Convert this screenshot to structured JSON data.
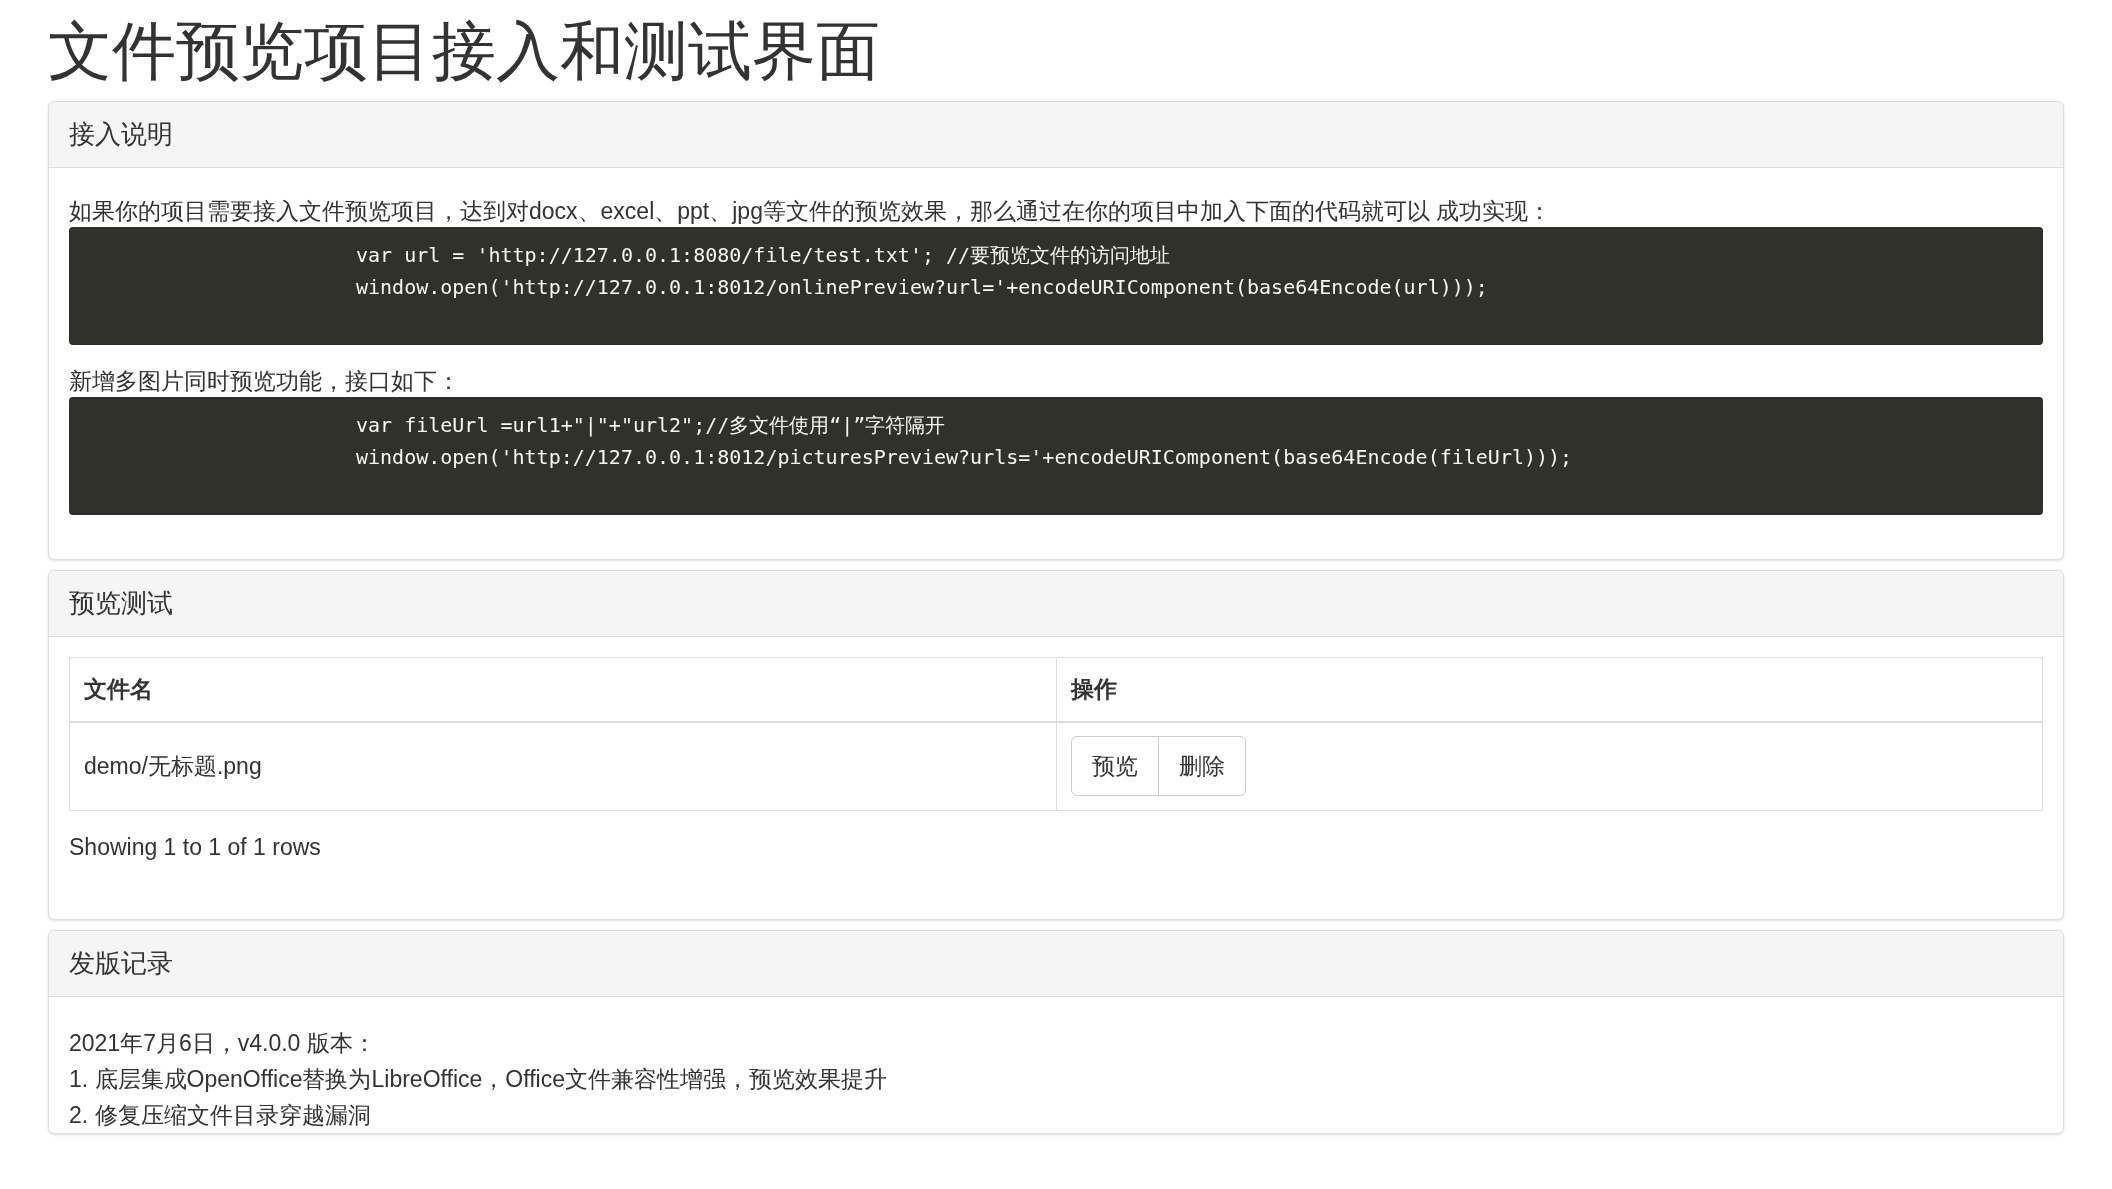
{
  "title": "文件预览项目接入和测试界面",
  "integration": {
    "heading": "接入说明",
    "intro": "如果你的项目需要接入文件预览项目，达到对docx、excel、ppt、jpg等文件的预览效果，那么通过在你的项目中加入下面的代码就可以 成功实现：",
    "code_1": [
      "var url = 'http://127.0.0.1:8080/file/test.txt'; //要预览文件的访问地址",
      "window.open('http://127.0.0.1:8012/onlinePreview?url='+encodeURIComponent(base64Encode(url)));"
    ],
    "multi_label": "新增多图片同时预览功能，接口如下：",
    "code_2": [
      "var fileUrl =url1+\"|\"+\"url2\";//多文件使用“|”字符隔开",
      "window.open('http://127.0.0.1:8012/picturesPreview?urls='+encodeURIComponent(base64Encode(fileUrl)));"
    ]
  },
  "preview_test": {
    "heading": "预览测试",
    "table": {
      "columns": [
        "文件名",
        "操作"
      ],
      "rows": [
        {
          "file": "demo/无标题.png",
          "actions": [
            "预览",
            "删除"
          ]
        }
      ]
    },
    "footer": "Showing 1 to 1 of 1 rows"
  },
  "release_notes": {
    "heading": "发版记录",
    "lines": [
      "2021年7月6日，v4.0.0 版本：",
      "1. 底层集成OpenOffice替换为LibreOffice，Office文件兼容性增强，预览效果提升",
      "2. 修复压缩文件目录穿越漏洞"
    ]
  }
}
